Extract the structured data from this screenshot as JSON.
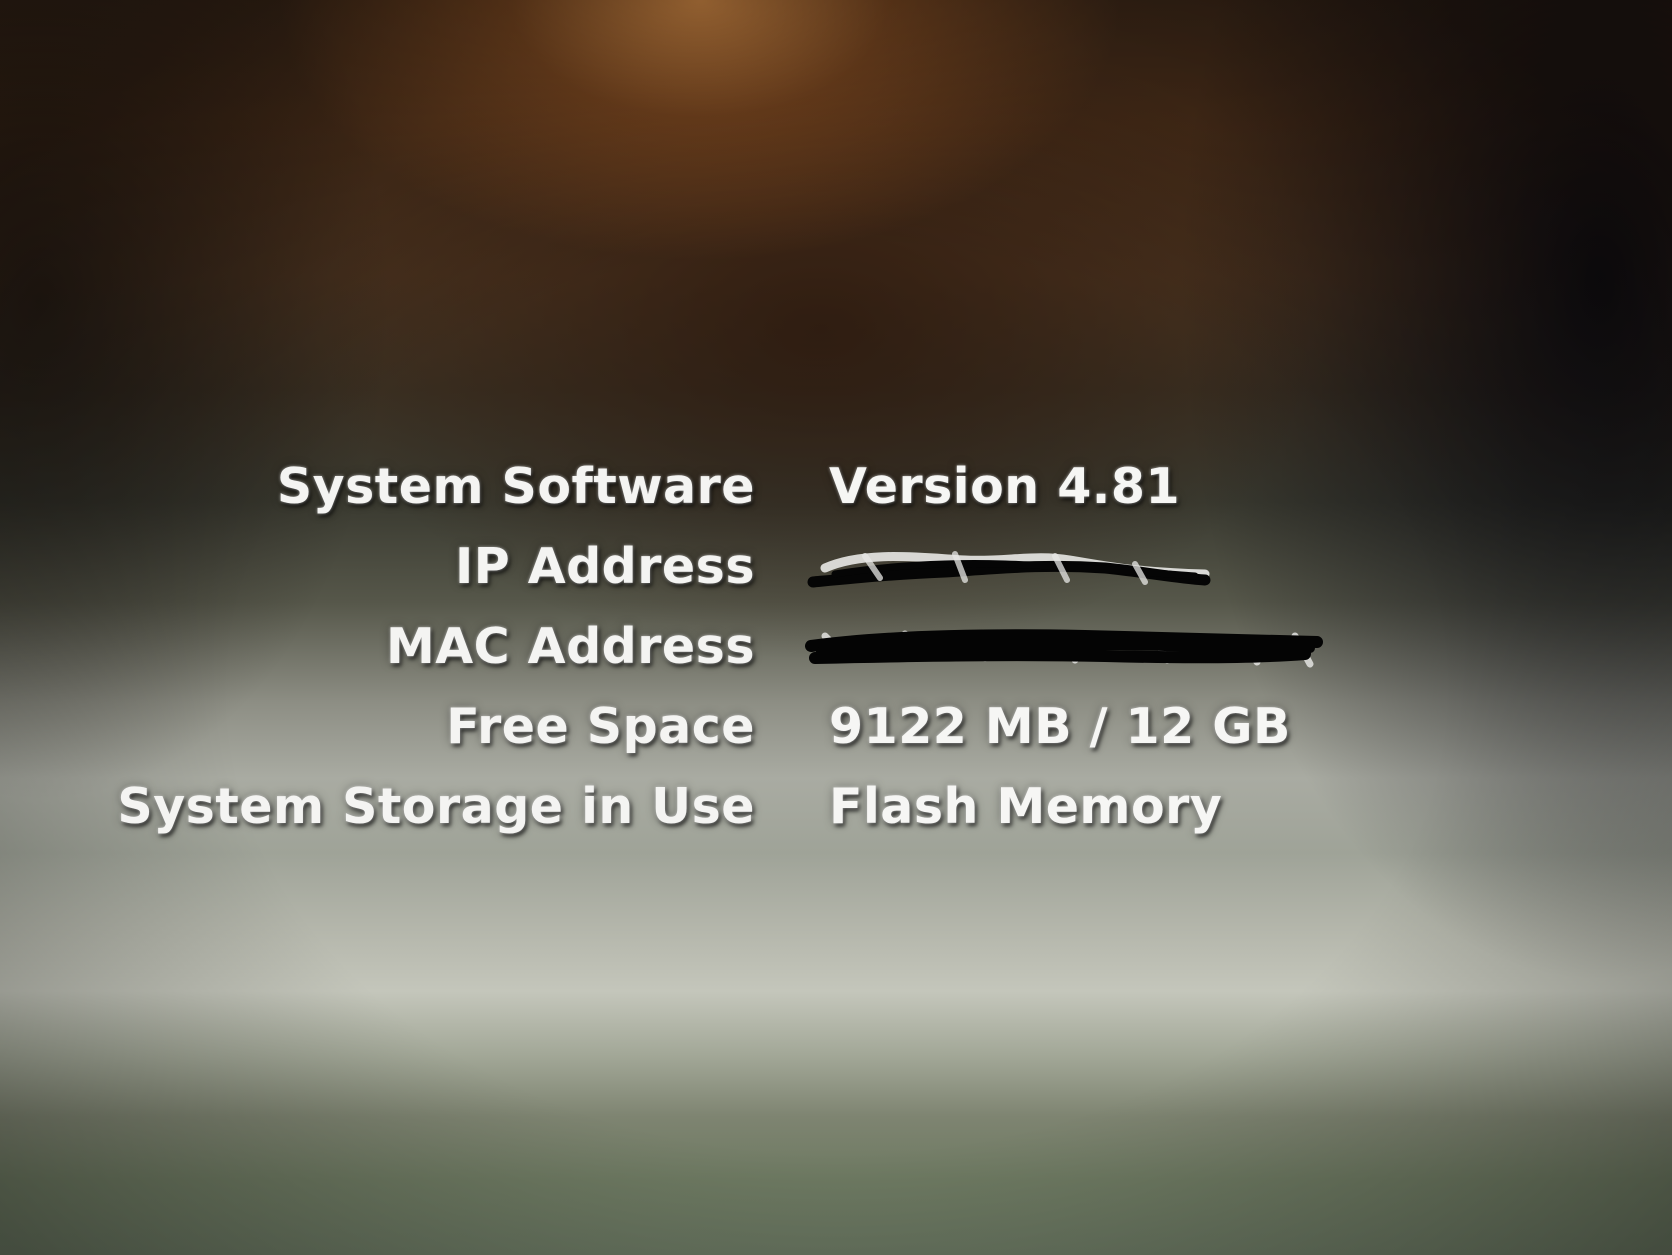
{
  "system_info": {
    "rows": [
      {
        "label": "System Software",
        "value": "Version 4.81"
      },
      {
        "label": "IP Address",
        "value": ""
      },
      {
        "label": "MAC Address",
        "value": ""
      },
      {
        "label": "Free Space",
        "value": "9122 MB / 12 GB"
      },
      {
        "label": "System Storage in Use",
        "value": "Flash Memory"
      }
    ]
  }
}
